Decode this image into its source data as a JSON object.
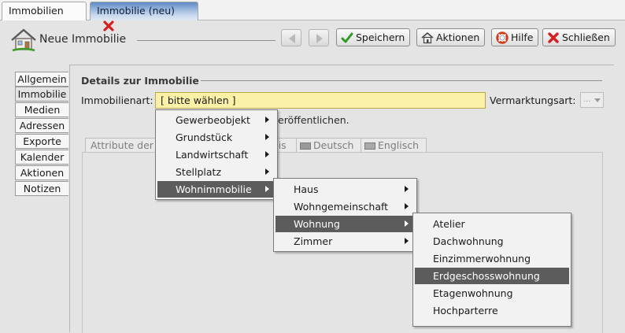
{
  "doc_tabs": [
    {
      "label": "Immobilien"
    },
    {
      "label": "Immobilie (neu)"
    }
  ],
  "header": {
    "title": "Neue Immobilie",
    "buttons": {
      "save": "Speichern",
      "actions": "Aktionen",
      "help": "Hilfe",
      "close": "Schließen"
    }
  },
  "sidebar": {
    "items": [
      "Allgemein",
      "Immobilie",
      "Medien",
      "Adressen",
      "Exporte",
      "Kalender",
      "Aktionen",
      "Notizen"
    ],
    "active": "Immobilie"
  },
  "section": {
    "title": "Details zur Immobilie",
    "property_type_label": "Immobilienart:",
    "property_type_value": "[ bitte wählen ]",
    "marketing_label": "Vermarktungsart:",
    "marketing_value": "...",
    "behind_text": "eröffentlichen."
  },
  "inner_tabs": [
    "Attribute der",
    "eis",
    "Deutsch",
    "Englisch"
  ],
  "menus": {
    "level1": [
      "Gewerbeobjekt",
      "Grundstück",
      "Landwirtschaft",
      "Stellplatz",
      "Wohnimmobilie"
    ],
    "level2": [
      "Haus",
      "Wohngemeinschaft",
      "Wohnung",
      "Zimmer"
    ],
    "level3": [
      "Atelier",
      "Dachwohnung",
      "Einzimmerwohnung",
      "Erdgeschosswohnung",
      "Etagenwohnung",
      "Hochparterre"
    ]
  },
  "selected": {
    "level1": "Wohnimmobilie",
    "level2": "Wohnung",
    "level3": "Erdgeschosswohnung"
  },
  "colors": {
    "selection": "#5c5c5c",
    "combo_background": "#fbf2a7",
    "active_tab": "#5f8bc6",
    "close_red": "#d32020",
    "save_green": "#2e9a1f"
  },
  "icons": {
    "title": "house-icon",
    "save": "checkmark-icon",
    "actions": "house-small-icon",
    "help": "lifebuoy-icon",
    "close": "red-x-icon"
  }
}
